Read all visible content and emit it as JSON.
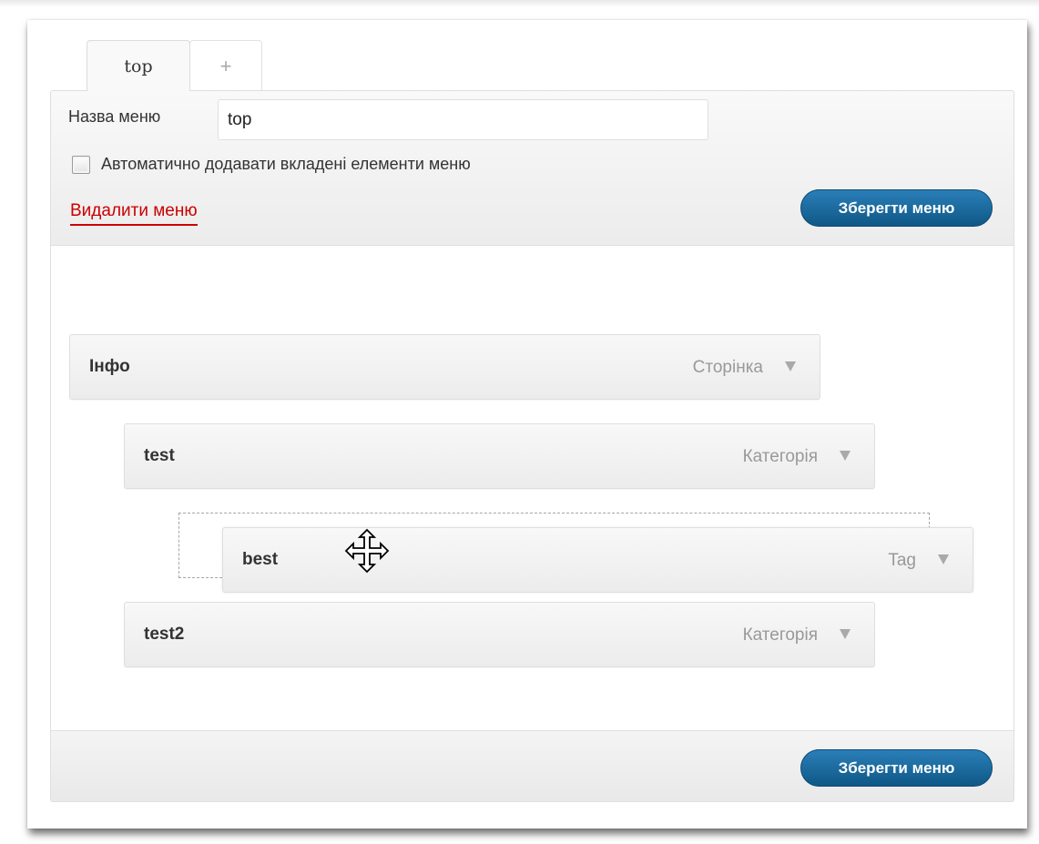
{
  "tabs": [
    {
      "label": "top"
    },
    {
      "label": "+"
    }
  ],
  "header": {
    "name_label": "Назва меню",
    "name_value": "top",
    "auto_add_label": "Автоматично додавати вкладені елементи меню",
    "auto_add_checked": false,
    "delete_label": "Видалити меню",
    "save_label": "Зберегти меню"
  },
  "items": [
    {
      "title": "Інфо",
      "type": "Сторінка"
    },
    {
      "title": "test",
      "type": "Категорія"
    },
    {
      "title": "best",
      "type": "Tag"
    },
    {
      "title": "test2",
      "type": "Категорія"
    }
  ],
  "footer": {
    "save_label": "Зберегти меню"
  },
  "icons": {
    "item_toggle": "triangle-down-icon",
    "drag_cursor": "move-cursor-icon"
  },
  "colors": {
    "delete": "#cc0000",
    "primary_button": "#145f8f",
    "item_type_text": "#999999"
  }
}
